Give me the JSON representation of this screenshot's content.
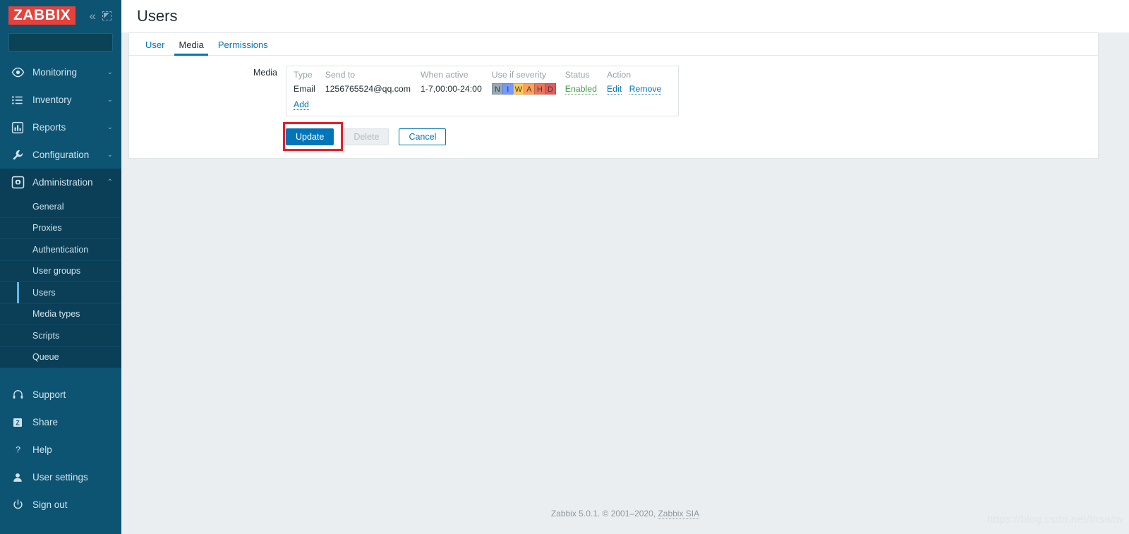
{
  "sidebar": {
    "logo": "ZABBIX",
    "collapse_icon": "chevrons-left-icon",
    "compact_icon": "compact-view-icon",
    "search": {
      "value": "",
      "placeholder": ""
    },
    "nav": [
      {
        "label": "Monitoring",
        "icon": "eye-icon",
        "chevron": "⌄",
        "expanded": false
      },
      {
        "label": "Inventory",
        "icon": "list-icon",
        "chevron": "⌄",
        "expanded": false
      },
      {
        "label": "Reports",
        "icon": "bar-chart-icon",
        "chevron": "⌄",
        "expanded": false
      },
      {
        "label": "Configuration",
        "icon": "wrench-icon",
        "chevron": "⌄",
        "expanded": false
      },
      {
        "label": "Administration",
        "icon": "gear-icon",
        "chevron": "⌃",
        "expanded": true
      }
    ],
    "submenu": [
      {
        "label": "General",
        "active": false
      },
      {
        "label": "Proxies",
        "active": false
      },
      {
        "label": "Authentication",
        "active": false
      },
      {
        "label": "User groups",
        "active": false
      },
      {
        "label": "Users",
        "active": true
      },
      {
        "label": "Media types",
        "active": false
      },
      {
        "label": "Scripts",
        "active": false
      },
      {
        "label": "Queue",
        "active": false
      }
    ],
    "bottom": [
      {
        "label": "Support",
        "icon": "headset-icon"
      },
      {
        "label": "Share",
        "icon": "zabbix-share-icon"
      },
      {
        "label": "Help",
        "icon": "question-mark-icon"
      },
      {
        "label": "User settings",
        "icon": "user-icon"
      },
      {
        "label": "Sign out",
        "icon": "power-icon"
      }
    ]
  },
  "header": {
    "title": "Users"
  },
  "tabs": [
    {
      "label": "User",
      "active": false
    },
    {
      "label": "Media",
      "active": true
    },
    {
      "label": "Permissions",
      "active": false
    }
  ],
  "form": {
    "media_label": "Media",
    "columns": [
      "Type",
      "Send to",
      "When active",
      "Use if severity",
      "Status",
      "Action"
    ],
    "rows": [
      {
        "type": "Email",
        "send_to": "1256765524@qq.com",
        "when_active": "1-7,00:00-24:00",
        "severity": [
          {
            "letter": "N",
            "name": "not-classified",
            "color": "#97aab3"
          },
          {
            "letter": "I",
            "name": "information",
            "color": "#7499ff"
          },
          {
            "letter": "W",
            "name": "warning",
            "color": "#ffc859"
          },
          {
            "letter": "A",
            "name": "average",
            "color": "#ffa059"
          },
          {
            "letter": "H",
            "name": "high",
            "color": "#e97659"
          },
          {
            "letter": "D",
            "name": "disaster",
            "color": "#e45959"
          }
        ],
        "status": "Enabled",
        "actions": [
          "Edit",
          "Remove"
        ]
      }
    ],
    "add_label": "Add"
  },
  "buttons": {
    "update": "Update",
    "delete": "Delete",
    "cancel": "Cancel"
  },
  "footer": {
    "text": "Zabbix 5.0.1. © 2001–2020, ",
    "link": "Zabbix SIA"
  },
  "watermark": "https://blog.csdn.net/Insistw"
}
